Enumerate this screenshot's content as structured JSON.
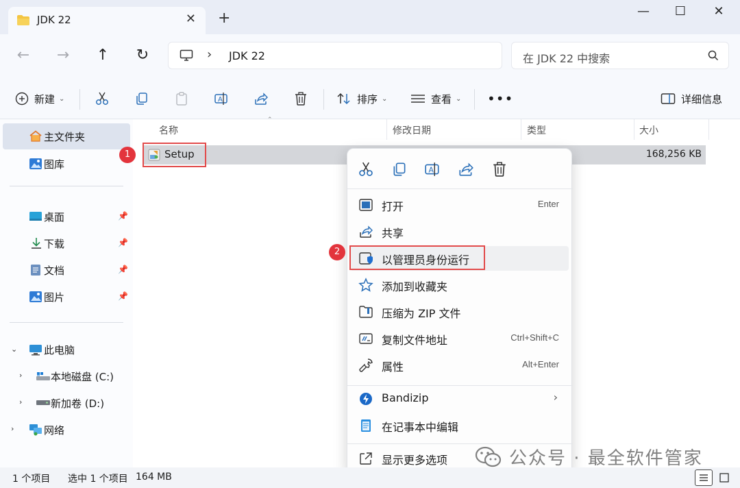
{
  "tab": {
    "title": "JDK 22"
  },
  "address": {
    "path": "JDK 22"
  },
  "search": {
    "placeholder": "在 JDK 22 中搜索"
  },
  "toolbar": {
    "new_label": "新建",
    "sort_label": "排序",
    "view_label": "查看",
    "details_label": "详细信息"
  },
  "sidebar": {
    "home": "主文件夹",
    "gallery": "图库",
    "desktop": "桌面",
    "downloads": "下载",
    "documents": "文档",
    "pictures": "图片",
    "this_pc": "此电脑",
    "drive_c": "本地磁盘 (C:)",
    "drive_d": "新加卷 (D:)",
    "network": "网络"
  },
  "columns": {
    "name": "名称",
    "modified": "修改日期",
    "type": "类型",
    "size": "大小"
  },
  "file": {
    "name": "Setup",
    "size": "168,256 KB"
  },
  "badges": {
    "one": "1",
    "two": "2"
  },
  "context_menu": {
    "open": "打开",
    "open_shortcut": "Enter",
    "share": "共享",
    "run_as_admin": "以管理员身份运行",
    "add_favorites": "添加到收藏夹",
    "compress_zip": "压缩为 ZIP 文件",
    "copy_path": "复制文件地址",
    "copy_path_shortcut": "Ctrl+Shift+C",
    "properties": "属性",
    "properties_shortcut": "Alt+Enter",
    "bandizip": "Bandizip",
    "edit_notepad": "在记事本中编辑",
    "more_options": "显示更多选项"
  },
  "status": {
    "count": "1 个项目",
    "selected": "选中 1 个项目",
    "size": "164 MB"
  },
  "watermark": {
    "text": "公众号 · 最全软件管家"
  },
  "colors": {
    "accent": "#0067c0",
    "badge": "#e3343c",
    "highlight_box": "#e24a4a",
    "folder": "#f4c542"
  }
}
